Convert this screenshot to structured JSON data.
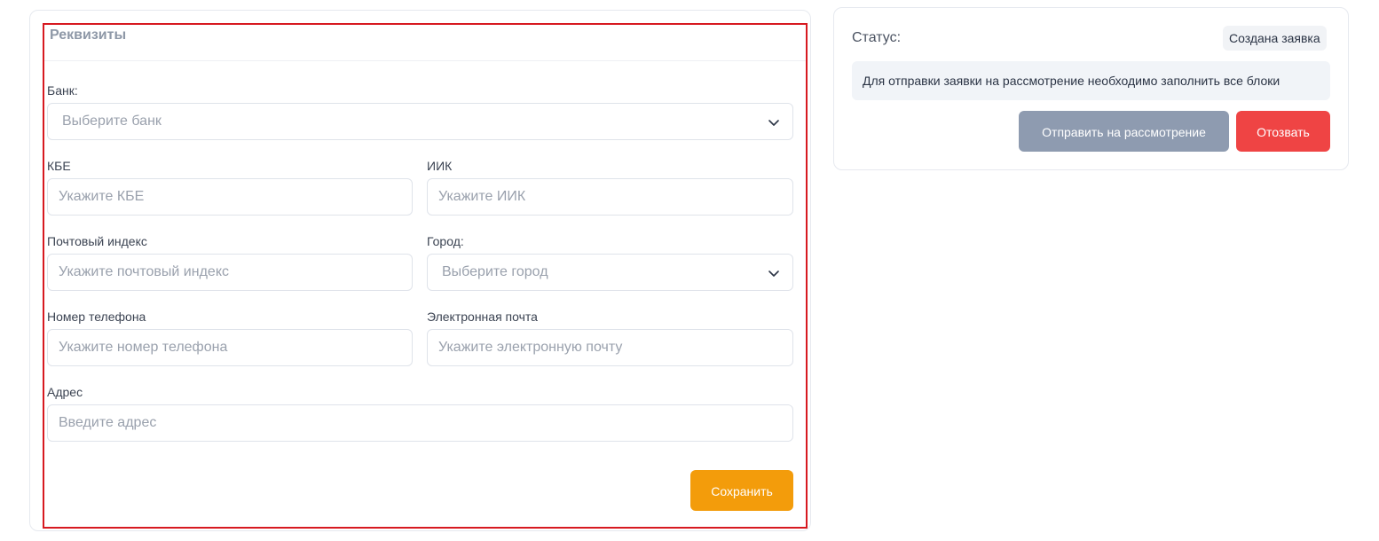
{
  "requisites": {
    "title": "Реквизиты",
    "bank": {
      "label": "Банк:",
      "placeholder": "Выберите банк"
    },
    "kbe": {
      "label": "КБЕ",
      "placeholder": "Укажите КБЕ"
    },
    "iik": {
      "label": "ИИК",
      "placeholder": "Укажите ИИК"
    },
    "postal": {
      "label": "Почтовый индекс",
      "placeholder": "Укажите почтовый индекс"
    },
    "city": {
      "label": "Город:",
      "placeholder": "Выберите город"
    },
    "phone": {
      "label": "Номер телефона",
      "placeholder": "Укажите номер телефона"
    },
    "email": {
      "label": "Электронная почта",
      "placeholder": "Укажите электронную почту"
    },
    "address": {
      "label": "Адрес",
      "placeholder": "Введите адрес"
    },
    "save_label": "Сохранить"
  },
  "status": {
    "label": "Статус:",
    "badge": "Создана заявка",
    "notice": "Для отправки заявки на рассмотрение необходимо заполнить все блоки",
    "submit_label": "Отправить на рассмотрение",
    "withdraw_label": "Отозвать"
  },
  "colors": {
    "accent_orange": "#f39c0b",
    "danger_red": "#ef4444",
    "disabled_gray": "#8e9bb0",
    "highlight_border": "#d71920"
  },
  "icons": {
    "bank_select": "chevron-down-icon",
    "city_select": "chevron-down-icon"
  }
}
